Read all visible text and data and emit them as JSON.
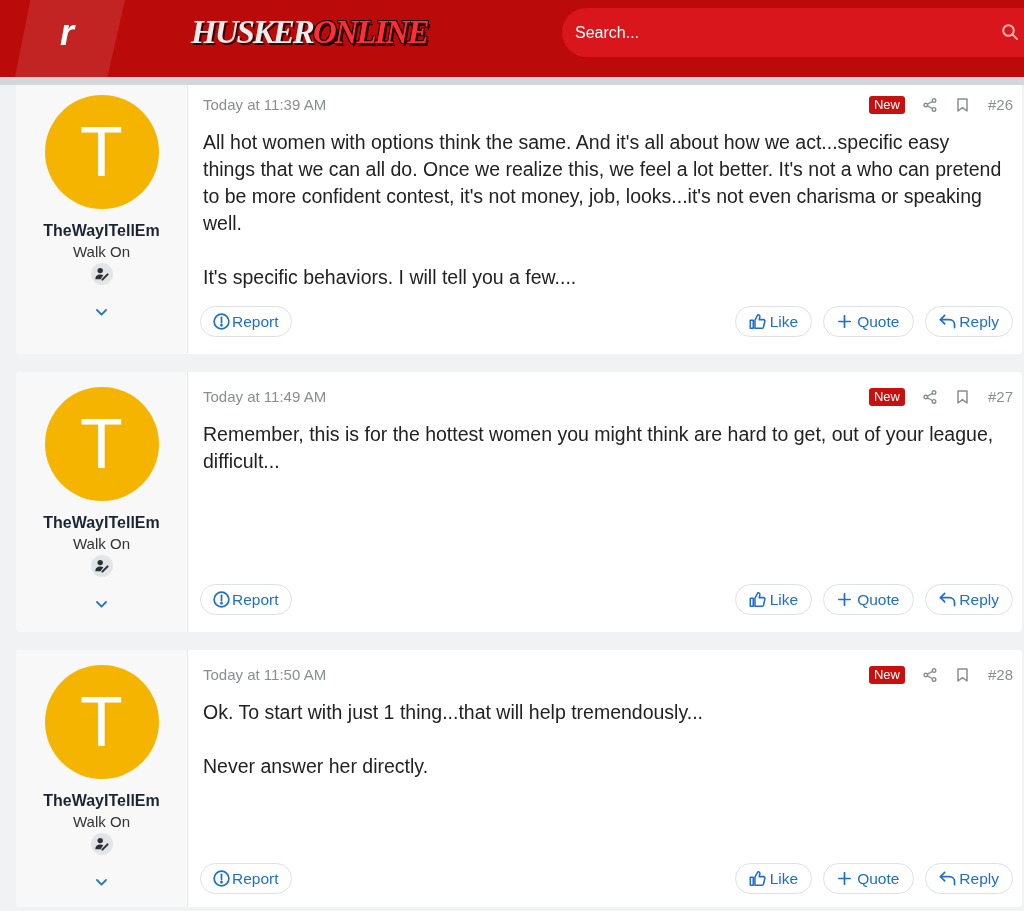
{
  "header": {
    "brand_mark": "r",
    "logo": {
      "first": "HUSKER",
      "second": "ONLINE"
    },
    "search": {
      "placeholder": "Search..."
    }
  },
  "posts": [
    {
      "author": {
        "initial": "T",
        "name": "TheWayITellEm",
        "title": "Walk On"
      },
      "time": "Today at 11:39 AM",
      "badge": "New",
      "number": "#26",
      "paragraphs": [
        "All hot women with options think the same. And it's all about how we act...specific easy things that we can all do. Once we realize this, we feel a lot better. It's not a who can pretend to be more confident contest, it's not money, job, looks...it's not even charisma or speaking well.",
        "It's specific behaviors. I will tell you a few...."
      ],
      "actions": [
        {
          "kind": "report",
          "label": "Report"
        },
        {
          "kind": "like",
          "label": "Like"
        },
        {
          "kind": "quote",
          "label": "Quote"
        },
        {
          "kind": "reply",
          "label": "Reply"
        }
      ]
    },
    {
      "author": {
        "initial": "T",
        "name": "TheWayITellEm",
        "title": "Walk On"
      },
      "time": "Today at 11:49 AM",
      "badge": "New",
      "number": "#27",
      "paragraphs": [
        "Remember, this is for the hottest women you might think are hard to get, out of your league, difficult..."
      ],
      "actions": [
        {
          "kind": "report",
          "label": "Report"
        },
        {
          "kind": "like",
          "label": "Like"
        },
        {
          "kind": "quote",
          "label": "Quote"
        },
        {
          "kind": "reply",
          "label": "Reply"
        }
      ]
    },
    {
      "author": {
        "initial": "T",
        "name": "TheWayITellEm",
        "title": "Walk On"
      },
      "time": "Today at 11:50 AM",
      "badge": "New",
      "number": "#28",
      "paragraphs": [
        "Ok. To start with just 1 thing...that will help tremendously...",
        "Never answer her directly."
      ],
      "actions": [
        {
          "kind": "report",
          "label": "Report"
        },
        {
          "kind": "like",
          "label": "Like"
        },
        {
          "kind": "quote",
          "label": "Quote"
        },
        {
          "kind": "reply",
          "label": "Reply"
        }
      ]
    }
  ]
}
